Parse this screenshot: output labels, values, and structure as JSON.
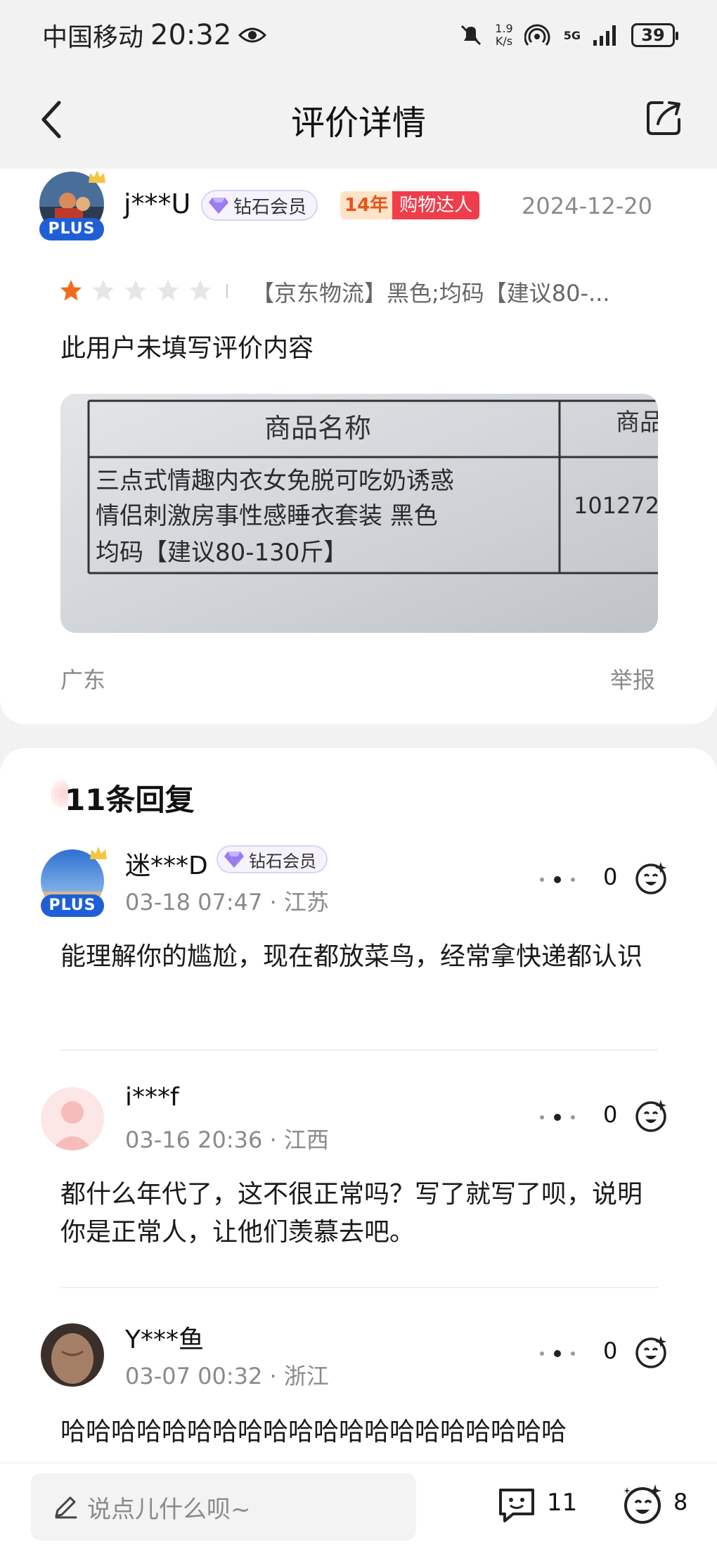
{
  "status_bar": {
    "carrier": "中国移动",
    "time": "20:32",
    "speed_value": "1.9",
    "speed_unit": "K/s",
    "network": "5G",
    "battery": "39"
  },
  "header": {
    "title": "评价详情"
  },
  "review": {
    "username": "j***U",
    "plus_label": "PLUS",
    "member_badge": "钻石会员",
    "years_label": "14年",
    "shopper_label": "购物达人",
    "date": "2024-12-20",
    "rating": 1,
    "max_rating": 5,
    "spec": "【京东物流】黑色;均码【建议80-...",
    "text": "此用户未填写评价内容",
    "photo_text": {
      "header_col1": "商品名称",
      "header_col2": "商品",
      "line1": "三点式情趣内衣女免脱可吃奶诱惑",
      "line2": "情侣刺激房事性感睡衣套装 黑色",
      "line3": "均码【建议80-130斤】",
      "sku": "101272"
    },
    "region": "广东",
    "report_label": "举报"
  },
  "replies_section": {
    "title": "11条回复",
    "items": [
      {
        "name": "迷***D",
        "plus_label": "PLUS",
        "member_badge": "钻石会员",
        "time": "03-18 07:47",
        "region": "江苏",
        "text": "能理解你的尴尬，现在都放菜鸟，经常拿快递都认识",
        "likes": "0"
      },
      {
        "name": "i***f",
        "time": "03-16 20:36",
        "region": "江西",
        "text": "都什么年代了，这不很正常吗？写了就写了呗，说明你是正常人，让他们羡慕去吧。",
        "likes": "0"
      },
      {
        "name": "Y***鱼",
        "time": "03-07 00:32",
        "region": "浙江",
        "text": "哈哈哈哈哈哈哈哈哈哈哈哈哈哈哈哈哈哈哈哈",
        "likes": "0"
      }
    ]
  },
  "bottom_bar": {
    "input_placeholder": "说点儿什么呗~",
    "comment_count": "11",
    "like_count": "8"
  },
  "colors": {
    "accent_star": "#f26b1d",
    "plus_blue": "#1e5fd6",
    "shopper_red": "#f03d4b"
  }
}
